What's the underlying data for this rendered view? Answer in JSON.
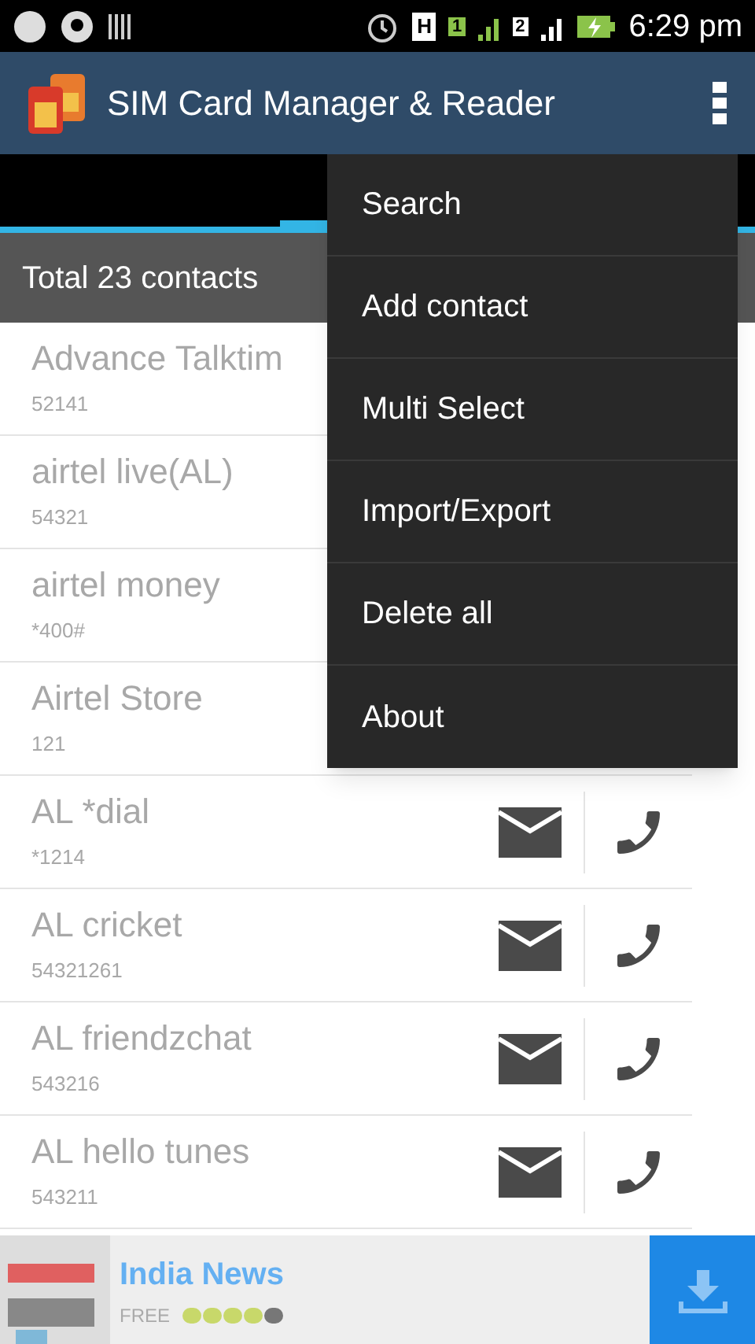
{
  "status_bar": {
    "time": "6:29 pm",
    "sim1": "1",
    "sim2": "2",
    "network": "H"
  },
  "app_bar": {
    "title": "SIM Card Manager & Reader"
  },
  "summary": "Total 23 contacts",
  "contacts": [
    {
      "name": "Advance Talktim",
      "number": "52141"
    },
    {
      "name": "airtel live(AL)",
      "number": "54321"
    },
    {
      "name": "airtel money",
      "number": "*400#"
    },
    {
      "name": "Airtel Store",
      "number": "121"
    },
    {
      "name": "AL *dial",
      "number": "*1214"
    },
    {
      "name": "AL cricket",
      "number": "54321261"
    },
    {
      "name": "AL friendzchat",
      "number": "543216"
    },
    {
      "name": "AL hello tunes",
      "number": "543211"
    }
  ],
  "menu": [
    "Search",
    "Add contact",
    "Multi Select",
    "Import/Export",
    "Delete all",
    "About"
  ],
  "ad": {
    "title": "India News",
    "label": "FREE",
    "stars": 4
  }
}
